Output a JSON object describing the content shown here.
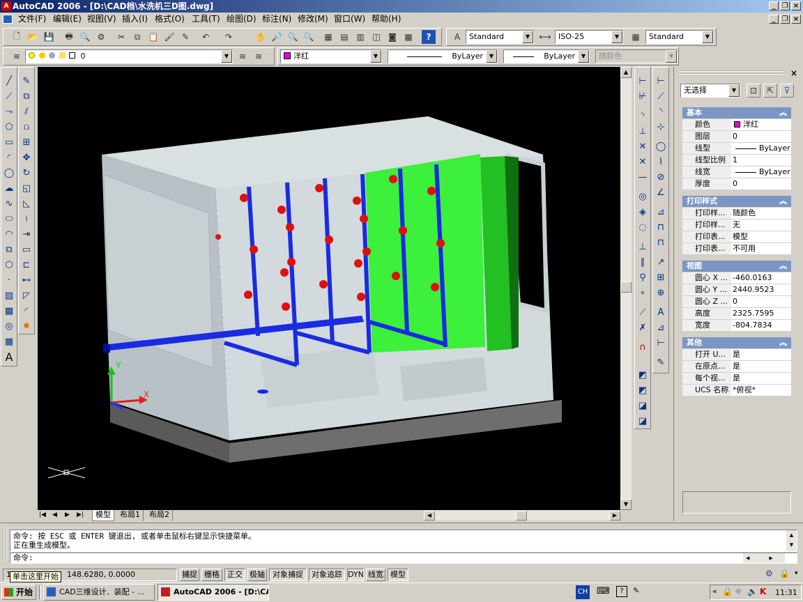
{
  "title": "AutoCAD 2006 - [D:\\CAD档\\水洗机三D图.dwg]",
  "menus": [
    "文件(F)",
    "编辑(E)",
    "视图(V)",
    "插入(I)",
    "格式(O)",
    "工具(T)",
    "绘图(D)",
    "标注(N)",
    "修改(M)",
    "窗口(W)",
    "帮助(H)"
  ],
  "styles": {
    "text_style": "Standard",
    "dim_style": "ISO-25",
    "table_style": "Standard"
  },
  "layers": {
    "current_layer": "0",
    "color": "洋红",
    "linetype": "ByLayer",
    "lineweight": "ByLayer",
    "plot_style": "随颜色"
  },
  "layout_tabs": [
    "模型",
    "布局1",
    "布局2"
  ],
  "ucs_axes": {
    "x": "X",
    "y": "Y"
  },
  "properties": {
    "selection": "无选择",
    "sections": {
      "basic": {
        "title": "基本",
        "rows": [
          {
            "k": "颜色",
            "v": "洋红"
          },
          {
            "k": "图层",
            "v": "0"
          },
          {
            "k": "线型",
            "v": "ByLayer"
          },
          {
            "k": "线型比例",
            "v": "1"
          },
          {
            "k": "线宽",
            "v": "ByLayer"
          },
          {
            "k": "厚度",
            "v": "0"
          }
        ]
      },
      "plot": {
        "title": "打印样式",
        "rows": [
          {
            "k": "打印样...",
            "v": "随颜色"
          },
          {
            "k": "打印样...",
            "v": "无"
          },
          {
            "k": "打印表...",
            "v": "模型"
          },
          {
            "k": "打印表...",
            "v": "不可用"
          }
        ]
      },
      "view": {
        "title": "视图",
        "rows": [
          {
            "k": "圆心 X ...",
            "v": "-460.0163"
          },
          {
            "k": "圆心 Y ...",
            "v": "2440.9523"
          },
          {
            "k": "圆心 Z ...",
            "v": "0"
          },
          {
            "k": "高度",
            "v": "2325.7595"
          },
          {
            "k": "宽度",
            "v": "-804.7834"
          }
        ]
      },
      "misc": {
        "title": "其他",
        "rows": [
          {
            "k": "打开 U...",
            "v": "是"
          },
          {
            "k": "在原点...",
            "v": "是"
          },
          {
            "k": "每个视...",
            "v": "是"
          },
          {
            "k": "UCS 名称",
            "v": "*俯视*"
          }
        ]
      }
    }
  },
  "command": {
    "line1": "命令: 按 ESC 或 ENTER 键退出, 或者单击鼠标右键显示快捷菜单。",
    "line2": "正在重生成模型。",
    "prompt": "命令:"
  },
  "status": {
    "coords_prefix": "1",
    "tooltip": "单击这里开始",
    "coords": "148.6280,  0.0000",
    "toggles": [
      "捕捉",
      "栅格",
      "正交",
      "极轴",
      "对象捕捉",
      "对象追踪",
      "DYN",
      "线宽",
      "模型"
    ]
  },
  "taskbar": {
    "start": "开始",
    "tasks": [
      "CAD三维设计．装配 - ...",
      "AutoCAD 2006 - [D:\\CA..."
    ],
    "ime": "CH",
    "clock": "11:31"
  },
  "colors": {
    "magenta": "#e000e0",
    "green_panel": "#3cf03c",
    "pipe_blue": "#1a2be0",
    "nozzle_red": "#e01010",
    "body_gray": "#c8d0d4"
  }
}
